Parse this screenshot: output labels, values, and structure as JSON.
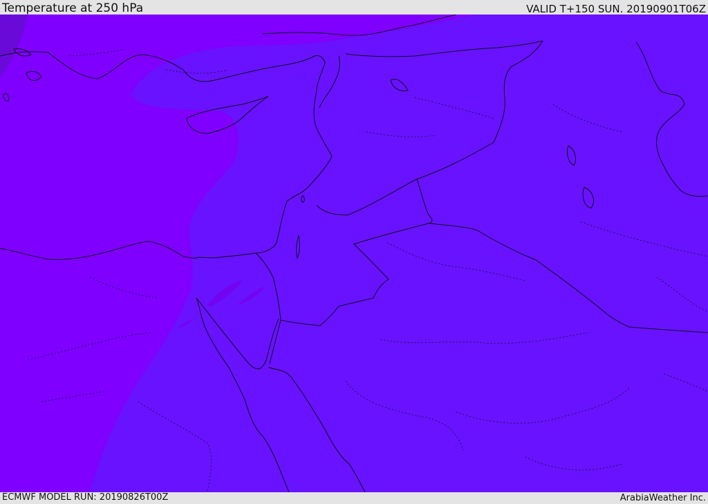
{
  "header": {
    "title": "Temperature at 250 hPa",
    "valid": "VALID T+150 SUN. 20190901T06Z"
  },
  "footer": {
    "model_run": "ECMWF MODEL RUN: 20190826T00Z",
    "credit": "ArabiaWeather Inc."
  },
  "map": {
    "colors": {
      "cold_region": "#7f00ff",
      "warmer_region": "#6812ff",
      "coldest_patch": "#6a0ad8",
      "coastline": "#111122"
    }
  }
}
